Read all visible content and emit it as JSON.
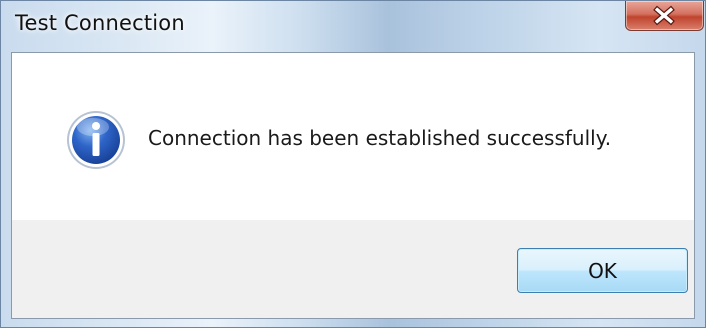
{
  "window": {
    "title": "Test Connection"
  },
  "dialog": {
    "icon": "info-icon",
    "message": "Connection has been established successfully.",
    "ok_label": "OK"
  },
  "colors": {
    "content_bg": "#ffffff",
    "footer_bg": "#f0f0f0",
    "close_button": "#c0432d",
    "ok_button_border": "#3c7fb1",
    "info_icon": "#2a5bbd"
  }
}
